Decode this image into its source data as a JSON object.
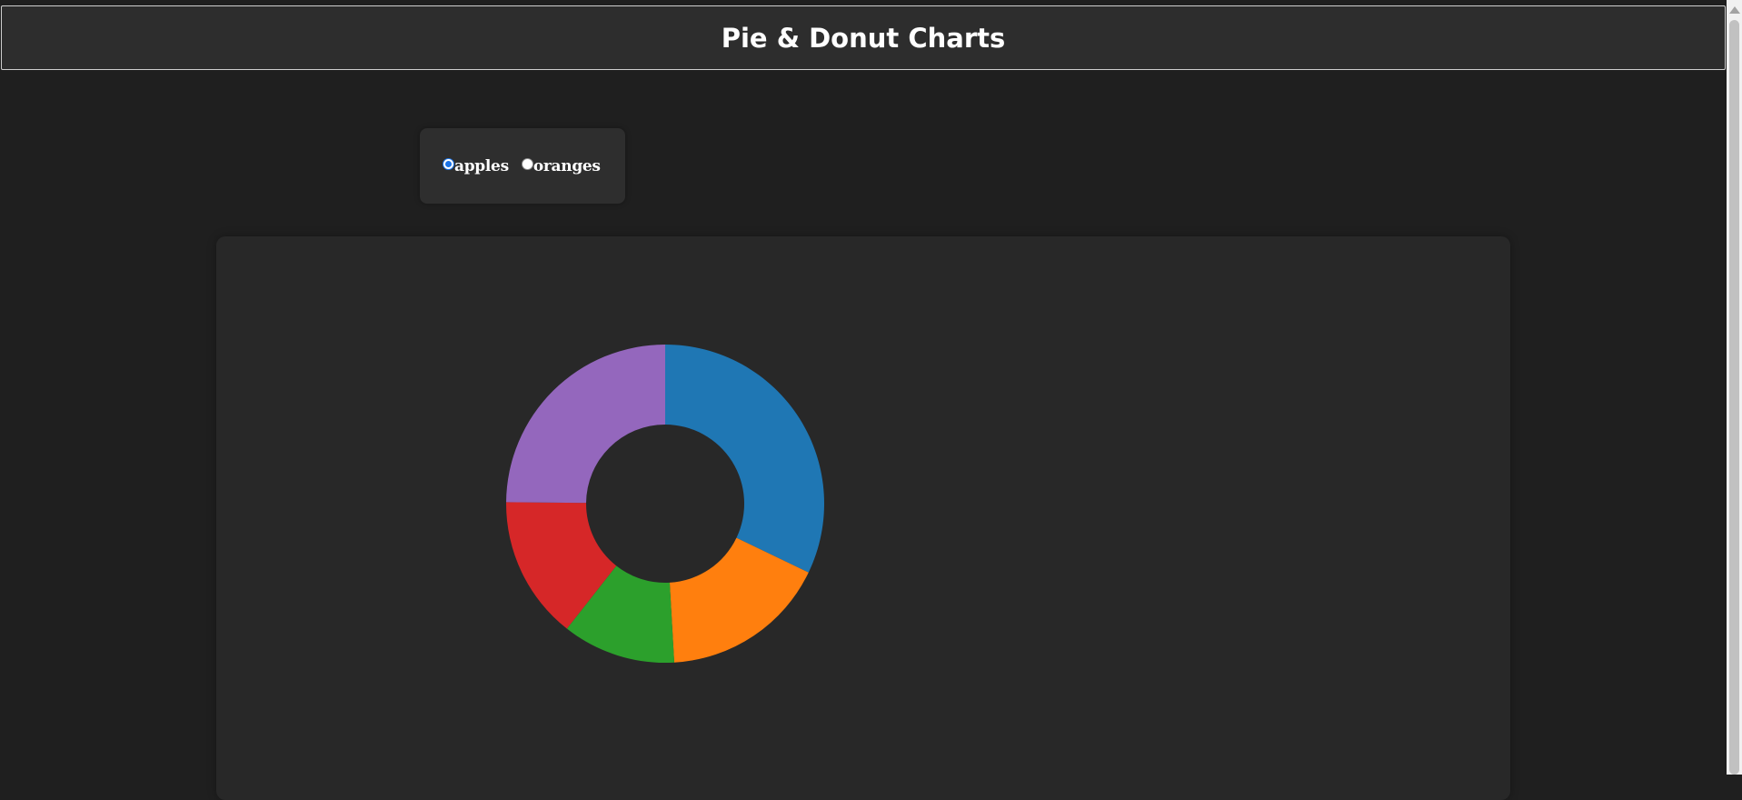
{
  "page": {
    "title": "Pie & Donut Charts"
  },
  "controls": {
    "options": [
      {
        "label": "apples",
        "checked": true
      },
      {
        "label": "oranges",
        "checked": false
      }
    ]
  },
  "colors": {
    "background": "#1f1f1f",
    "header": "#2d2d2d",
    "card": "#282828",
    "radio_accent": "#1a73e8"
  },
  "chart_data": {
    "type": "pie",
    "variant": "donut",
    "title": "",
    "selected_series": "apples",
    "values": [
      53,
      28,
      19,
      24,
      41
    ],
    "colors": [
      "#1f77b4",
      "#ff7f0e",
      "#2ca02c",
      "#d62728",
      "#9467bd"
    ],
    "start_angle": "top",
    "direction": "clockwise",
    "legend": "none"
  }
}
